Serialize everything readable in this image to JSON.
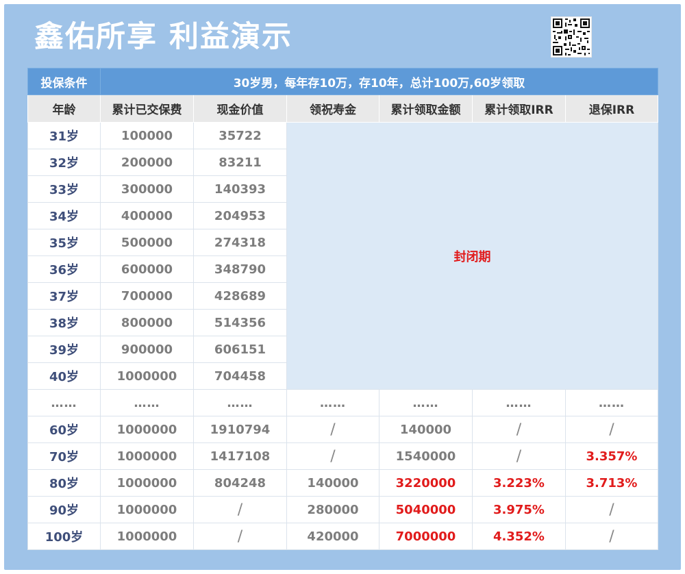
{
  "title": "鑫佑所享 利益演示",
  "qr_code": "qr-code-icon",
  "conditions": {
    "label": "投保条件",
    "text": "30岁男，每年存10万，存10年，总计100万,60岁领取"
  },
  "columns": [
    "年龄",
    "累计已交保费",
    "现金价值",
    "领祝寿金",
    "累计领取金额",
    "累计领取IRR",
    "退保IRR"
  ],
  "closed_label": "封闭期",
  "early_rows": [
    {
      "age": "31岁",
      "premium": "100000",
      "cash": "35722"
    },
    {
      "age": "32岁",
      "premium": "200000",
      "cash": "83211"
    },
    {
      "age": "33岁",
      "premium": "300000",
      "cash": "140393"
    },
    {
      "age": "34岁",
      "premium": "400000",
      "cash": "204953"
    },
    {
      "age": "35岁",
      "premium": "500000",
      "cash": "274318"
    },
    {
      "age": "36岁",
      "premium": "600000",
      "cash": "348790"
    },
    {
      "age": "37岁",
      "premium": "700000",
      "cash": "428689"
    },
    {
      "age": "38岁",
      "premium": "800000",
      "cash": "514356"
    },
    {
      "age": "39岁",
      "premium": "900000",
      "cash": "606151"
    },
    {
      "age": "40岁",
      "premium": "1000000",
      "cash": "704458"
    }
  ],
  "ellipsis_row": [
    "……",
    "……",
    "……",
    "……",
    "……",
    "……",
    "……"
  ],
  "late_rows": [
    {
      "age": "60岁",
      "premium": "1000000",
      "cash": "1910794",
      "bonus": "/",
      "total": "140000",
      "total_irr": "/",
      "surrender_irr": "/"
    },
    {
      "age": "70岁",
      "premium": "1000000",
      "cash": "1417108",
      "bonus": "/",
      "total": "1540000",
      "total_irr": "/",
      "surrender_irr": "3.357%"
    },
    {
      "age": "80岁",
      "premium": "1000000",
      "cash": "804248",
      "bonus": "140000",
      "total": "3220000",
      "total_irr": "3.223%",
      "surrender_irr": "3.713%"
    },
    {
      "age": "90岁",
      "premium": "1000000",
      "cash": "/",
      "bonus": "280000",
      "total": "5040000",
      "total_irr": "3.975%",
      "surrender_irr": "/"
    },
    {
      "age": "100岁",
      "premium": "1000000",
      "cash": "/",
      "bonus": "420000",
      "total": "7000000",
      "total_irr": "4.352%",
      "surrender_irr": "/"
    }
  ],
  "colors": {
    "frame": "#9fc3e8",
    "header_bar": "#5e9ad8",
    "highlight_red": "#e11b1b",
    "closed_bg": "#dce9f6"
  }
}
